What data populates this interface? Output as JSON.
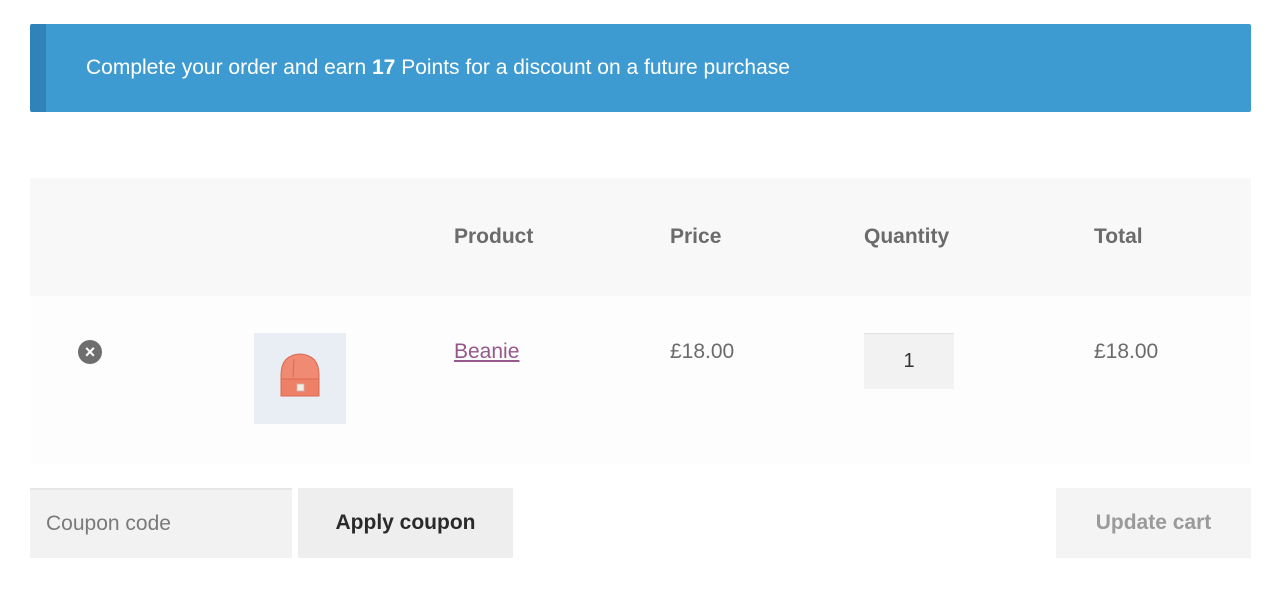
{
  "notice": {
    "prefix": "Complete your order and earn ",
    "points": "17",
    "suffix": " Points for a discount on a future purchase"
  },
  "table": {
    "headers": {
      "product": "Product",
      "price": "Price",
      "quantity": "Quantity",
      "total": "Total"
    },
    "rows": [
      {
        "remove_icon": "×",
        "product": "Beanie",
        "price": "£18.00",
        "quantity": "1",
        "total": "£18.00"
      }
    ]
  },
  "actions": {
    "coupon_placeholder": "Coupon code",
    "apply_coupon": "Apply coupon",
    "update_cart": "Update cart"
  },
  "colors": {
    "notice_bg": "#3e9bd2",
    "notice_border": "#2f83b8",
    "link": "#96588a"
  }
}
